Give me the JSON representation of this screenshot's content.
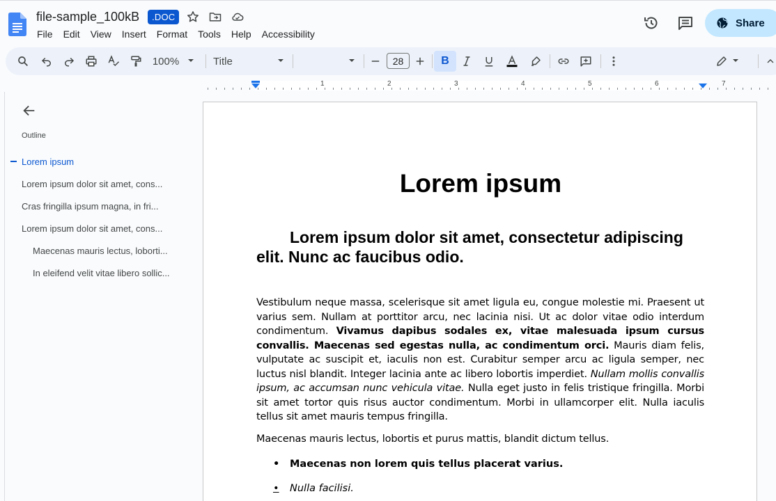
{
  "header": {
    "title": "file-sample_100kB",
    "badge": ".DOC",
    "menus": [
      "File",
      "Edit",
      "View",
      "Insert",
      "Format",
      "Tools",
      "Help",
      "Accessibility"
    ],
    "share_label": "Share"
  },
  "toolbar": {
    "zoom": "100%",
    "style": "Title",
    "font_size": "28",
    "bold_label": "B"
  },
  "ruler": {
    "numbers": [
      "1",
      "2",
      "3",
      "4",
      "5",
      "6",
      "7"
    ]
  },
  "outline": {
    "heading": "Outline",
    "items": [
      "Lorem ipsum",
      "Lorem ipsum dolor sit amet, cons...",
      "Cras fringilla ipsum magna, in fri...",
      "Lorem ipsum dolor sit amet, cons...",
      "Maecenas mauris lectus, loborti...",
      "In eleifend velit vitae libero sollic..."
    ]
  },
  "document": {
    "title": "Lorem ipsum",
    "heading": "Lorem ipsum dolor sit amet, consectetur adipiscing elit. Nunc ac faucibus odio.",
    "p1_a": "Vestibulum neque massa, scelerisque sit amet ligula eu, congue molestie mi. Praesent ut varius sem. Nullam at porttitor arcu, nec lacinia nisi. Ut ac dolor vitae odio interdum condimentum. ",
    "p1_b": "Vivamus dapibus sodales ex, vitae malesuada ipsum cursus convallis. Maecenas sed egestas nulla, ac condimentum orci.",
    "p1_c": " Mauris diam felis, vulputate ac suscipit et, iaculis non est. Curabitur semper arcu ac ligula semper, nec luctus nisl blandit. Integer lacinia ante ac libero lobortis imperdiet. ",
    "p1_d": "Nullam mollis convallis ipsum, ac accumsan nunc vehicula vitae.",
    "p1_e": " Nulla eget justo in felis tristique fringilla. Morbi sit amet tortor quis risus auctor condimentum. Morbi in ullamcorper elit. Nulla iaculis tellus sit amet mauris tempus fringilla.",
    "p2": "Maecenas mauris lectus, lobortis et purus mattis, blandit dictum tellus.",
    "bullet_char": "•",
    "bullets": [
      "Maecenas non lorem quis tellus placerat varius.",
      "Nulla facilisi."
    ]
  }
}
